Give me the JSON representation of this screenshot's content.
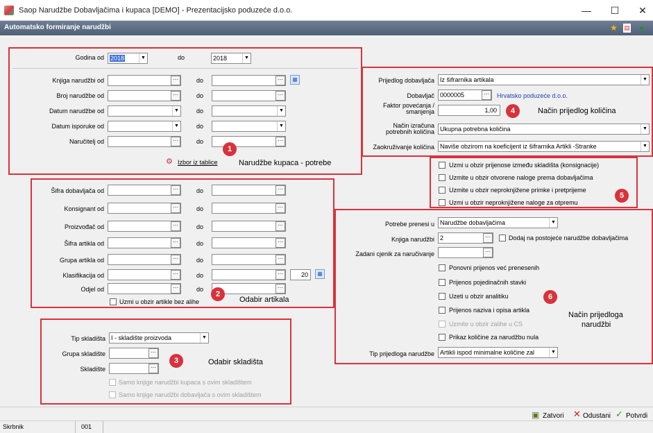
{
  "window": {
    "title": "Saop Narudžbe Dobavljačima i kupaca [DEMO] - Prezentacijsko poduzeće d.o.o.",
    "minimize": "—",
    "maximize": "☐",
    "close": "✕"
  },
  "header": {
    "title": "Automatsko formiranje narudžbi"
  },
  "panel1": {
    "godina_od_label": "Godina od",
    "godina_od_value": "2018",
    "do_label": "do",
    "godina_do_value": "2018",
    "rows": [
      {
        "label": "Knjiga narudžbi od",
        "do": "do"
      },
      {
        "label": "Broj narudžbe od",
        "do": "do"
      },
      {
        "label": "Datum narudžbe od",
        "do": "do"
      },
      {
        "label": "Datum isporuke od",
        "do": "do"
      },
      {
        "label": "Naručitelj od",
        "do": "do"
      }
    ],
    "izbor_link": "Izbor iz tablice",
    "badge": "1",
    "note": "Narudžbe kupaca - potrebe"
  },
  "panel2": {
    "rows": [
      {
        "label": "Šifra dobavljača od",
        "do": "do"
      },
      {
        "label": "Konsignant od",
        "do": "do"
      },
      {
        "label": "Proizvođač od",
        "do": "do"
      },
      {
        "label": "Šifra artikla od",
        "do": "do"
      },
      {
        "label": "Grupa artikla od",
        "do": "do"
      },
      {
        "label": "Klasifikacija od",
        "do": "do"
      },
      {
        "label": "Odjel od",
        "do": "do"
      }
    ],
    "klas_num": "20",
    "checkbox": "Uzmi u obzir artikle bez alihe",
    "badge": "2",
    "note": "Odabir artikala"
  },
  "panel3": {
    "tip_label": "Tip skladišta",
    "tip_value": "I - skladište proizvoda",
    "grupa_label": "Grupa skladište",
    "skladiste_label": "Skladište",
    "chk1": "Samo knjige narudžbi kupaca s ovim skladištem",
    "chk2": "Samo knjige narudžbi dobavljača s ovim skladištem",
    "badge": "3",
    "note": "Odabir skladišta"
  },
  "panel4": {
    "prijedlog_label": "Prijedlog dobavljača",
    "prijedlog_value": "Iz šifrarnika artikala",
    "dobavljac_label": "Dobavljač",
    "dobavljac_value": "0000005",
    "dobavljac_name": "Hrvatsko poduzeće d.o.o.",
    "faktor_label1": "Faktor povećanja /",
    "faktor_label2": "smanjenja",
    "faktor_value": "1,00",
    "nacin_label1": "Način izračuna",
    "nacin_label2": "potrebnih količina",
    "nacin_value": "Ukupna potrebna količina",
    "zaokr_label": "Zaokruživanje količina",
    "zaokr_value": "Naviše obzirom na koeficijent iz šifrarnika Artikli -Stranke",
    "badge": "4",
    "note": "Način prijedlog količina"
  },
  "panel5": {
    "items": [
      "Uzmi u obzir prijenose između skladišta (konsignacije)",
      "Uzmite u obzir otvorene naloge prema dobavljačima",
      "Uzmite u obzir neproknjižene primke i pretprijeme",
      "Uzmi u obzir neproknjižene naloge za otpremu"
    ],
    "badge": "5"
  },
  "panel6": {
    "potrebe_label": "Potrebe prenesi u",
    "potrebe_value": "Narudžbe dobavljačima",
    "knjiga_label": "Knjiga narudžbi",
    "knjiga_value": "2",
    "dodaj_label": "Dodaj na postojeće narudžbe dobavljačima",
    "cjenik_label": "Zadani cjenik za naručivanje",
    "items": [
      "Ponovni prijenos već prenesenih",
      "Prijenos pojedinačnih stavki",
      "Uzeti u obzir analitiku",
      "Prijenos naziva i opisa artikla",
      "Uzmite u obzir zalihe u CS",
      "Prikaz količine za narudžbu nula"
    ],
    "tip_label": "Tip prijedloga narudžbe",
    "tip_value": "Artikli ispod minimalne količine zal",
    "badge": "6",
    "note1": "Način prijedloga",
    "note2": "narudžbi"
  },
  "footer": {
    "zatvori": "Zatvori",
    "odustani": "Odustani",
    "potvrdi": "Potvrdi"
  },
  "statusbar": {
    "label": "Skrbnik",
    "value": "001"
  },
  "colors": {
    "accent_red": "#d8323c",
    "header_bg": "#5a6a80"
  }
}
